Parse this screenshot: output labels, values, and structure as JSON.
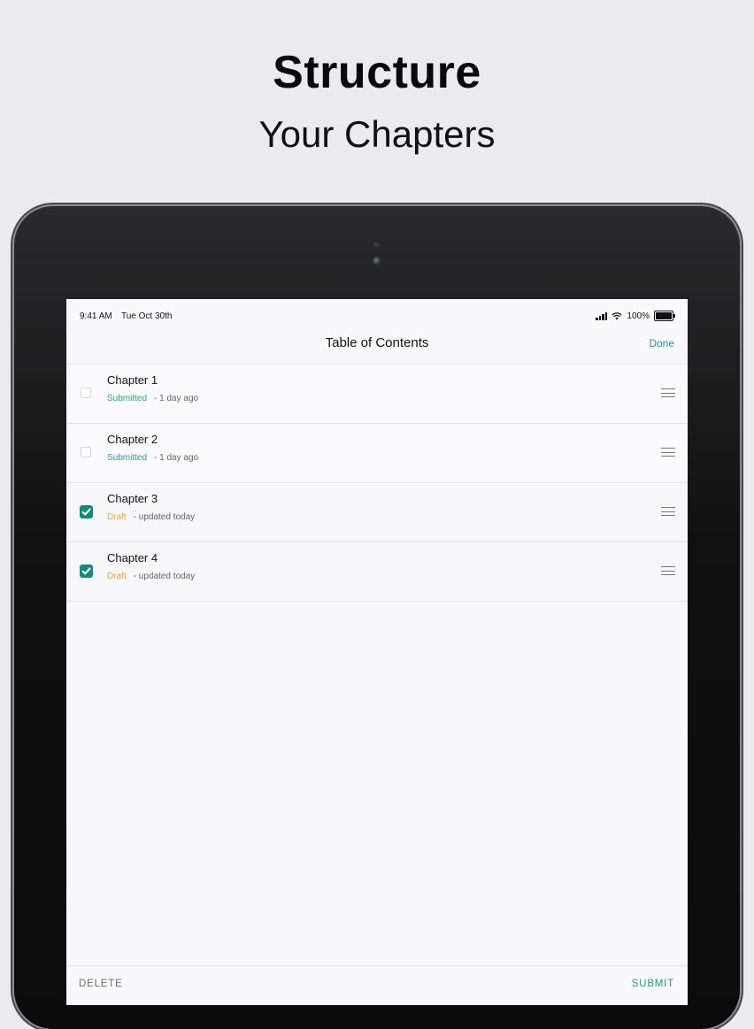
{
  "promo": {
    "headline": "Structure",
    "subline": "Your Chapters"
  },
  "status_bar": {
    "time": "9:41 AM",
    "date": "Tue Oct 30th",
    "battery": "100%"
  },
  "nav": {
    "title": "Table of Contents",
    "done_label": "Done"
  },
  "chapters": [
    {
      "title": "Chapter 1",
      "status": "Submitted",
      "time": "- 1 day ago",
      "checked": false
    },
    {
      "title": "Chapter 2",
      "status": "Submitted",
      "time": "- 1 day ago",
      "checked": false
    },
    {
      "title": "Chapter 3",
      "status": "Draft",
      "time": "- updated today",
      "checked": true
    },
    {
      "title": "Chapter 4",
      "status": "Draft",
      "time": "- updated today",
      "checked": true
    }
  ],
  "toolbar": {
    "delete_label": "DELETE",
    "submit_label": "SUBMIT"
  },
  "colors": {
    "accent": "#2a9a7c",
    "checkbox_checked": "#14897c",
    "submitted": "#2e9f80",
    "draft": "#e8a54a"
  },
  "icons": {
    "checkbox": "checkmark-icon",
    "reorder": "drag-handle-icon",
    "signal": "cellular-signal-icon",
    "wifi": "wifi-icon",
    "battery": "battery-icon"
  }
}
